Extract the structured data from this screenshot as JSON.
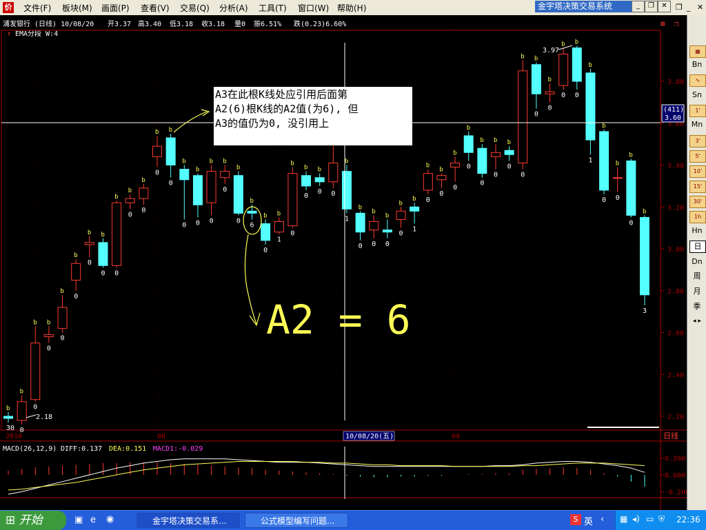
{
  "app": {
    "window_title": "金宇塔决策交易系统",
    "menus": [
      "文件(F)",
      "板块(M)",
      "画面(P)",
      "查看(V)",
      "交易(Q)",
      "分析(A)",
      "工具(T)",
      "窗口(W)",
      "帮助(H)"
    ]
  },
  "header": {
    "stock": "浦发银行 (日线) 10/08/20",
    "open": "开3.37",
    "high": "高3.40",
    "low": "低3.18",
    "close": "收3.18",
    "volume": "量0",
    "amplitude": "振6.51%",
    "change": "跌(0.23)6.60%",
    "indicator": "EMA分段 W:4"
  },
  "price_axis": {
    "labels": [
      "3.80",
      "3.60",
      "3.40",
      "3.20",
      "3.00",
      "2.80",
      "2.60",
      "2.40",
      "2.20"
    ],
    "cursor_box": [
      "(411)",
      "3.60"
    ]
  },
  "date_axis": {
    "labels": [
      "2010",
      "08",
      "09"
    ],
    "cursor_date": "10/08/20(五)",
    "period": "日线"
  },
  "macd": {
    "label": "MACD(26,12,9)",
    "diff": "DIFF:0.137",
    "dea": "DEA:0.151",
    "macd1": "MACD1:-0.029",
    "axis": [
      "0.200",
      "0.000",
      "-0.200"
    ]
  },
  "annotation": {
    "lines": [
      "A3在此根K线处应引用后面第",
      "A2(6)根K线的A2值(为6), 但",
      "A3的值仍为0, 没引用上"
    ],
    "handwritten": "A2 = 6",
    "circle_value": "6"
  },
  "price_labels": {
    "peak": "3.97",
    "low_start": "2.18",
    "start": "30"
  },
  "colors": {
    "up": "#ff3b30",
    "down": "#54ffff",
    "accent": "#ffff55",
    "annotation": "#ffffff"
  },
  "chart_data": {
    "type": "candlestick",
    "ylim": [
      2.15,
      4.0
    ],
    "candles": [
      {
        "o": 2.2,
        "c": 2.19,
        "h": 2.22,
        "l": 2.17,
        "tag": "30"
      },
      {
        "o": 2.18,
        "c": 2.27,
        "h": 2.3,
        "l": 2.16,
        "tag": "0"
      },
      {
        "o": 2.28,
        "c": 2.55,
        "h": 2.63,
        "l": 2.27,
        "tag": "0"
      },
      {
        "o": 2.58,
        "c": 2.59,
        "h": 2.63,
        "l": 2.55,
        "tag": "0"
      },
      {
        "o": 2.62,
        "c": 2.72,
        "h": 2.78,
        "l": 2.6,
        "tag": "0"
      },
      {
        "o": 2.85,
        "c": 2.93,
        "h": 2.95,
        "l": 2.8,
        "tag": "0"
      },
      {
        "o": 3.02,
        "c": 3.03,
        "h": 3.06,
        "l": 2.96,
        "tag": "0"
      },
      {
        "o": 3.03,
        "c": 2.92,
        "h": 3.05,
        "l": 2.91,
        "tag": "0"
      },
      {
        "o": 2.92,
        "c": 3.22,
        "h": 3.23,
        "l": 2.91,
        "tag": "0"
      },
      {
        "o": 3.22,
        "c": 3.24,
        "h": 3.26,
        "l": 3.19,
        "tag": "0"
      },
      {
        "o": 3.24,
        "c": 3.29,
        "h": 3.31,
        "l": 3.21,
        "tag": "0"
      },
      {
        "o": 3.44,
        "c": 3.49,
        "h": 3.54,
        "l": 3.39,
        "tag": "0"
      },
      {
        "o": 3.53,
        "c": 3.4,
        "h": 3.55,
        "l": 3.34,
        "tag": "0"
      },
      {
        "o": 3.38,
        "c": 3.33,
        "h": 3.4,
        "l": 3.14,
        "tag": "0"
      },
      {
        "o": 3.35,
        "c": 3.21,
        "h": 3.36,
        "l": 3.15,
        "tag": "0"
      },
      {
        "o": 3.22,
        "c": 3.37,
        "h": 3.4,
        "l": 3.16,
        "tag": "0"
      },
      {
        "o": 3.34,
        "c": 3.37,
        "h": 3.4,
        "l": 3.31,
        "tag": "0"
      },
      {
        "o": 3.35,
        "c": 3.17,
        "h": 3.37,
        "l": 3.16,
        "tag": "0"
      },
      {
        "o": 3.18,
        "c": 3.17,
        "h": 3.21,
        "l": 3.14,
        "tag": "6"
      },
      {
        "o": 3.12,
        "c": 3.04,
        "h": 3.14,
        "l": 3.02,
        "tag": "0"
      },
      {
        "o": 3.08,
        "c": 3.13,
        "h": 3.15,
        "l": 3.07,
        "tag": "1"
      },
      {
        "o": 3.11,
        "c": 3.36,
        "h": 3.39,
        "l": 3.1,
        "tag": "0"
      },
      {
        "o": 3.35,
        "c": 3.3,
        "h": 3.37,
        "l": 3.28,
        "tag": "0"
      },
      {
        "o": 3.34,
        "c": 3.32,
        "h": 3.36,
        "l": 3.3,
        "tag": "0"
      },
      {
        "o": 3.32,
        "c": 3.41,
        "h": 3.5,
        "l": 3.29,
        "tag": "0"
      },
      {
        "o": 3.37,
        "c": 3.19,
        "h": 3.4,
        "l": 3.17,
        "tag": "1"
      },
      {
        "o": 3.17,
        "c": 3.08,
        "h": 3.18,
        "l": 3.04,
        "tag": "0"
      },
      {
        "o": 3.09,
        "c": 3.13,
        "h": 3.16,
        "l": 3.05,
        "tag": "0"
      },
      {
        "o": 3.09,
        "c": 3.08,
        "h": 3.14,
        "l": 3.05,
        "tag": "0"
      },
      {
        "o": 3.14,
        "c": 3.18,
        "h": 3.2,
        "l": 3.1,
        "tag": "0"
      },
      {
        "o": 3.2,
        "c": 3.18,
        "h": 3.22,
        "l": 3.12,
        "tag": "1"
      },
      {
        "o": 3.28,
        "c": 3.36,
        "h": 3.38,
        "l": 3.26,
        "tag": "0"
      },
      {
        "o": 3.33,
        "c": 3.35,
        "h": 3.36,
        "l": 3.29,
        "tag": "0"
      },
      {
        "o": 3.39,
        "c": 3.41,
        "h": 3.44,
        "l": 3.32,
        "tag": "0"
      },
      {
        "o": 3.54,
        "c": 3.46,
        "h": 3.56,
        "l": 3.42,
        "tag": "0"
      },
      {
        "o": 3.48,
        "c": 3.36,
        "h": 3.5,
        "l": 3.34,
        "tag": "0"
      },
      {
        "o": 3.44,
        "c": 3.46,
        "h": 3.5,
        "l": 3.38,
        "tag": "0"
      },
      {
        "o": 3.47,
        "c": 3.45,
        "h": 3.49,
        "l": 3.42,
        "tag": "0"
      },
      {
        "o": 3.41,
        "c": 3.85,
        "h": 3.9,
        "l": 3.38,
        "tag": "0"
      },
      {
        "o": 3.88,
        "c": 3.74,
        "h": 3.89,
        "l": 3.67,
        "tag": "0"
      },
      {
        "o": 3.74,
        "c": 3.75,
        "h": 3.79,
        "l": 3.7,
        "tag": "0"
      },
      {
        "o": 3.78,
        "c": 3.93,
        "h": 3.96,
        "l": 3.76,
        "tag": "0"
      },
      {
        "o": 3.96,
        "c": 3.8,
        "h": 3.97,
        "l": 3.76,
        "tag": "0"
      },
      {
        "o": 3.84,
        "c": 3.52,
        "h": 3.86,
        "l": 3.45,
        "tag": "1"
      },
      {
        "o": 3.56,
        "c": 3.28,
        "h": 3.57,
        "l": 3.26,
        "tag": "0"
      },
      {
        "o": 3.34,
        "c": 3.34,
        "h": 3.39,
        "l": 3.27,
        "tag": "0"
      },
      {
        "o": 3.42,
        "c": 3.16,
        "h": 3.43,
        "l": 3.15,
        "tag": "0"
      },
      {
        "o": 3.15,
        "c": 2.78,
        "h": 3.16,
        "l": 2.73,
        "tag": "3"
      }
    ],
    "macd_hist": [
      0.05,
      0.07,
      0.09,
      0.1,
      0.11,
      0.12,
      0.13,
      0.14,
      0.14,
      0.15,
      0.15,
      0.15,
      0.14,
      0.13,
      0.12,
      0.11,
      0.1,
      0.09,
      0.08,
      0.06,
      0.05,
      0.04,
      0.03,
      0.02,
      0.01,
      -0.01,
      -0.02,
      -0.03,
      -0.03,
      -0.02,
      -0.02,
      -0.01,
      -0.01,
      0.0,
      0.01,
      0.01,
      0.02,
      0.02,
      0.06,
      0.07,
      0.08,
      0.09,
      0.08,
      0.06,
      0.02,
      -0.02,
      -0.08,
      -0.14
    ],
    "diff_line": [
      -0.23,
      -0.2,
      -0.16,
      -0.12,
      -0.08,
      -0.04,
      0.0,
      0.04,
      0.08,
      0.11,
      0.14,
      0.16,
      0.18,
      0.19,
      0.19,
      0.19,
      0.19,
      0.18,
      0.17,
      0.16,
      0.15,
      0.15,
      0.15,
      0.14,
      0.13,
      0.12,
      0.11,
      0.1,
      0.1,
      0.1,
      0.1,
      0.1,
      0.1,
      0.1,
      0.1,
      0.1,
      0.11,
      0.11,
      0.12,
      0.14,
      0.15,
      0.16,
      0.16,
      0.15,
      0.13,
      0.11,
      0.08,
      0.03
    ],
    "dea_line": [
      -0.18,
      -0.17,
      -0.15,
      -0.13,
      -0.11,
      -0.09,
      -0.06,
      -0.03,
      0.0,
      0.03,
      0.06,
      0.08,
      0.1,
      0.12,
      0.13,
      0.14,
      0.15,
      0.16,
      0.16,
      0.16,
      0.16,
      0.16,
      0.15,
      0.15,
      0.14,
      0.14,
      0.13,
      0.12,
      0.12,
      0.11,
      0.11,
      0.11,
      0.11,
      0.1,
      0.1,
      0.1,
      0.1,
      0.1,
      0.11,
      0.11,
      0.12,
      0.13,
      0.14,
      0.14,
      0.14,
      0.13,
      0.12,
      0.11
    ],
    "macd_ylim": [
      -0.25,
      0.3
    ]
  },
  "taskbar": {
    "start": "开始",
    "tasks": [
      "金宇塔决策交易系...",
      "公式模型编写问题..."
    ],
    "ime": "英",
    "time": "22:36"
  },
  "right_panel": [
    "Bn",
    "Sn",
    "Mn",
    "Hn",
    "日",
    "Dn",
    "周",
    "月",
    "季"
  ]
}
